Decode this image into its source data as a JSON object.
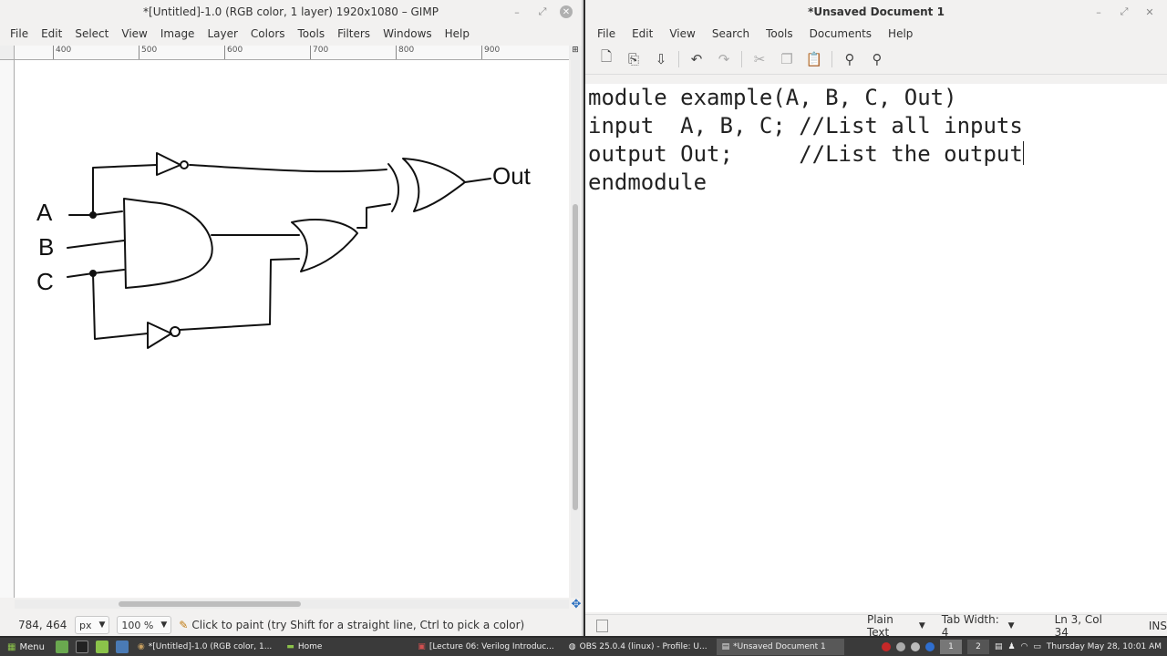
{
  "gimp": {
    "title": "*[Untitled]-1.0 (RGB color, 1 layer) 1920x1080 – GIMP",
    "menu": [
      "File",
      "Edit",
      "Select",
      "View",
      "Image",
      "Layer",
      "Colors",
      "Tools",
      "Filters",
      "Windows",
      "Help"
    ],
    "ruler_ticks": [
      "400",
      "500",
      "600",
      "700",
      "800",
      "900"
    ],
    "canvas_labels": {
      "a": "A",
      "b": "B",
      "c": "C",
      "out": "Out"
    },
    "status": {
      "coords": "784, 464",
      "unit": "px",
      "zoom": "100 %",
      "hint": "Click to paint (try Shift for a straight line, Ctrl to pick a color)"
    }
  },
  "editor": {
    "title": "*Unsaved Document 1",
    "menu": [
      "File",
      "Edit",
      "View",
      "Search",
      "Tools",
      "Documents",
      "Help"
    ],
    "toolbar_icons": [
      "new-document-icon",
      "open-icon",
      "save-icon",
      "undo-icon",
      "redo-icon",
      "cut-icon",
      "copy-icon",
      "paste-icon",
      "find-icon",
      "find-replace-icon"
    ],
    "code_lines": [
      "module example(A, B, C, Out)",
      "input  A, B, C; //List all inputs",
      "output Out;     //List the output",
      "endmodule"
    ],
    "status": {
      "language": "Plain Text",
      "tab_width": "Tab Width:  4",
      "position": "Ln 3, Col 34",
      "mode": "INS"
    }
  },
  "taskbar": {
    "menu_label": "Menu",
    "tasks": [
      "*[Untitled]-1.0 (RGB color, 1...",
      "Home",
      "[Lecture 06: Verilog Introduc...",
      "OBS 25.0.4 (linux) - Profile: U...",
      "*Unsaved Document 1"
    ],
    "workspaces": [
      "1",
      "2"
    ],
    "clock": "Thursday May 28, 10:01 AM"
  }
}
